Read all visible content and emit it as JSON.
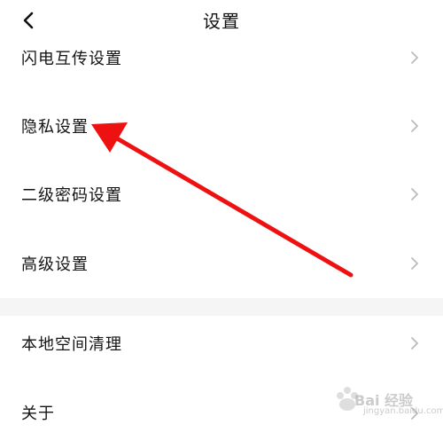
{
  "header": {
    "title": "设置",
    "back_icon": "chevron-left-icon"
  },
  "settings": {
    "items": [
      {
        "label": "闪电互传设置",
        "icon": "chevron-right-icon"
      },
      {
        "label": "隐私设置",
        "icon": "chevron-right-icon"
      },
      {
        "label": "二级密码设置",
        "icon": "chevron-right-icon"
      },
      {
        "label": "高级设置",
        "icon": "chevron-right-icon"
      },
      {
        "label": "本地空间清理",
        "icon": "chevron-right-icon"
      },
      {
        "label": "关于",
        "icon": "chevron-right-icon"
      }
    ]
  },
  "annotation": {
    "type": "arrow",
    "color": "#ee1111",
    "points_to": "隐私设置"
  },
  "watermark": {
    "text": "Bai 经验",
    "subtext": "jingyan.baidu.com",
    "color": "#a0a0a0"
  },
  "colors": {
    "background": "#ffffff",
    "section_gap": "#f5f5f5",
    "text": "#141414",
    "chevron": "#bbbbbb"
  }
}
